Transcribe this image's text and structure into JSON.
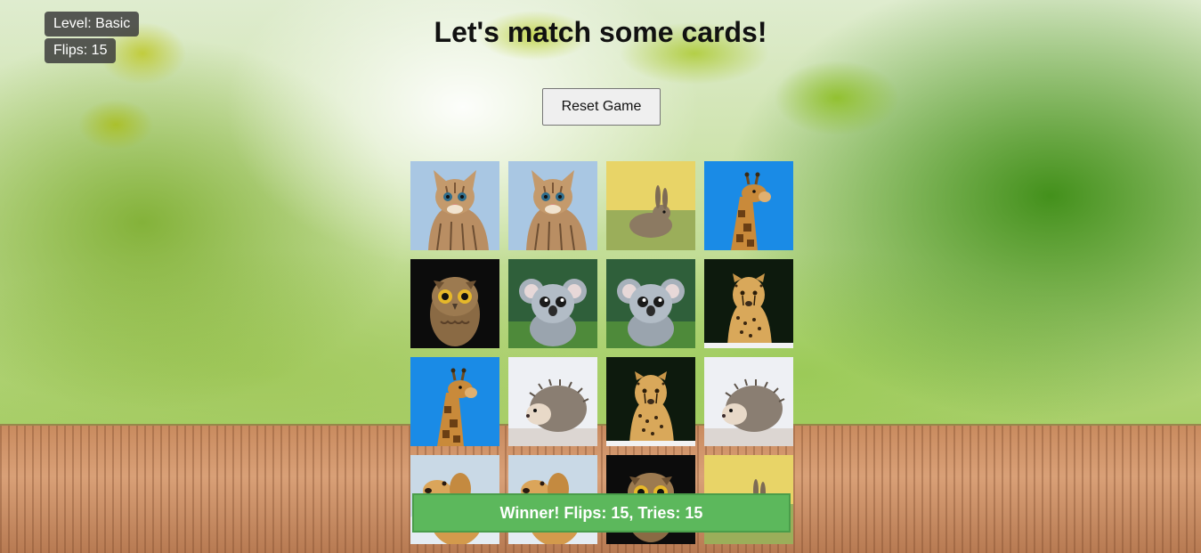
{
  "hud": {
    "level": "Level: Basic",
    "flips": "Flips: 15"
  },
  "header": {
    "title": "Let's match some cards!"
  },
  "controls": {
    "reset_label": "Reset Game"
  },
  "board": {
    "rows": 4,
    "cols": 4,
    "cards": [
      {
        "animal": "cat"
      },
      {
        "animal": "cat"
      },
      {
        "animal": "rabbit"
      },
      {
        "animal": "giraffe"
      },
      {
        "animal": "owl"
      },
      {
        "animal": "koala"
      },
      {
        "animal": "koala"
      },
      {
        "animal": "cheetah"
      },
      {
        "animal": "giraffe"
      },
      {
        "animal": "hedgehog"
      },
      {
        "animal": "cheetah"
      },
      {
        "animal": "hedgehog"
      },
      {
        "animal": "dog"
      },
      {
        "animal": "dog"
      },
      {
        "animal": "owl"
      },
      {
        "animal": "rabbit"
      }
    ]
  },
  "result": {
    "message": "Winner! Flips: 15, Tries: 15"
  }
}
